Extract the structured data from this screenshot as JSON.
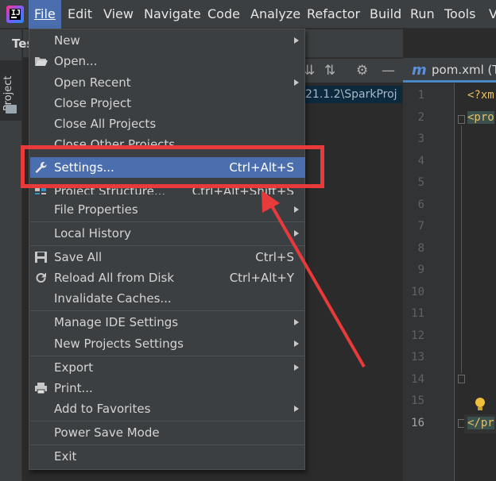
{
  "menubar": {
    "items": [
      {
        "label": "File",
        "mnemonic": "F"
      },
      {
        "label": "Edit",
        "mnemonic": "E"
      },
      {
        "label": "View",
        "mnemonic": "V"
      },
      {
        "label": "Navigate",
        "mnemonic": "N"
      },
      {
        "label": "Code",
        "mnemonic": "C"
      },
      {
        "label": "Analyze",
        "mnemonic": "z"
      },
      {
        "label": "Refactor",
        "mnemonic": "R"
      },
      {
        "label": "Build",
        "mnemonic": "B"
      },
      {
        "label": "Run",
        "mnemonic": "u"
      },
      {
        "label": "Tools",
        "mnemonic": "T"
      },
      {
        "label": "V"
      }
    ]
  },
  "project_panel": {
    "header_title": "Tes",
    "path_text": "21.1.2\\SparkProj"
  },
  "left_strip": {
    "tool_tab_label": "Project"
  },
  "editor": {
    "tab_icon_letter": "m",
    "tab_label": "pom.xml (T",
    "line_numbers": [
      "1",
      "2",
      "3",
      "4",
      "5",
      "6",
      "7",
      "8",
      "9",
      "10",
      "11",
      "12",
      "13",
      "14",
      "15",
      "16"
    ],
    "current_line": "16",
    "code": {
      "line1": "<?xm",
      "line2": "<pro",
      "line16": "</pr"
    }
  },
  "file_menu": {
    "items": [
      {
        "label": "New",
        "mnemonic": "N",
        "shortcut": "",
        "submenu": true
      },
      {
        "label": "Open...",
        "mnemonic": "O",
        "shortcut": "",
        "icon": "folder-open-icon"
      },
      {
        "label": "Open Recent",
        "mnemonic": "R",
        "shortcut": "",
        "submenu": true
      },
      {
        "label": "Close Project",
        "shortcut": ""
      },
      {
        "label": "Close All Projects",
        "shortcut": ""
      },
      {
        "label": "Close Other Projects",
        "shortcut": "",
        "obscured": true
      },
      {
        "label": "Settings...",
        "mnemonic": "t",
        "shortcut": "Ctrl+Alt+S",
        "icon": "wrench-icon",
        "selected": true
      },
      {
        "label": "Project Structure...",
        "shortcut": "Ctrl+Alt+Shift+S",
        "icon": "project-structure-icon",
        "obscured": true
      },
      {
        "label": "File Properties",
        "shortcut": "",
        "submenu": true
      },
      {
        "label": "Local History",
        "mnemonic": "H",
        "shortcut": "",
        "submenu": true
      },
      {
        "label": "Save All",
        "mnemonic": "S",
        "shortcut": "Ctrl+S",
        "icon": "save-icon"
      },
      {
        "label": "Reload All from Disk",
        "shortcut": "Ctrl+Alt+Y",
        "icon": "reload-icon"
      },
      {
        "label": "Invalidate Caches...",
        "shortcut": ""
      },
      {
        "label": "Manage IDE Settings",
        "shortcut": "",
        "submenu": true
      },
      {
        "label": "New Projects Settings",
        "shortcut": "",
        "submenu": true
      },
      {
        "label": "Export",
        "shortcut": "",
        "submenu": true
      },
      {
        "label": "Print...",
        "mnemonic": "P",
        "shortcut": "",
        "icon": "print-icon"
      },
      {
        "label": "Add to Favorites",
        "mnemonic": "v",
        "shortcut": "",
        "submenu": true
      },
      {
        "label": "Power Save Mode",
        "shortcut": ""
      },
      {
        "label": "Exit",
        "mnemonic": "x",
        "shortcut": ""
      }
    ]
  },
  "annotation": {
    "color": "#e83a3a",
    "target": "Settings..."
  },
  "colors": {
    "menu_bg": "#3c3f41",
    "selection": "#4b6eaf",
    "editor_bg": "#2b2b2b"
  }
}
